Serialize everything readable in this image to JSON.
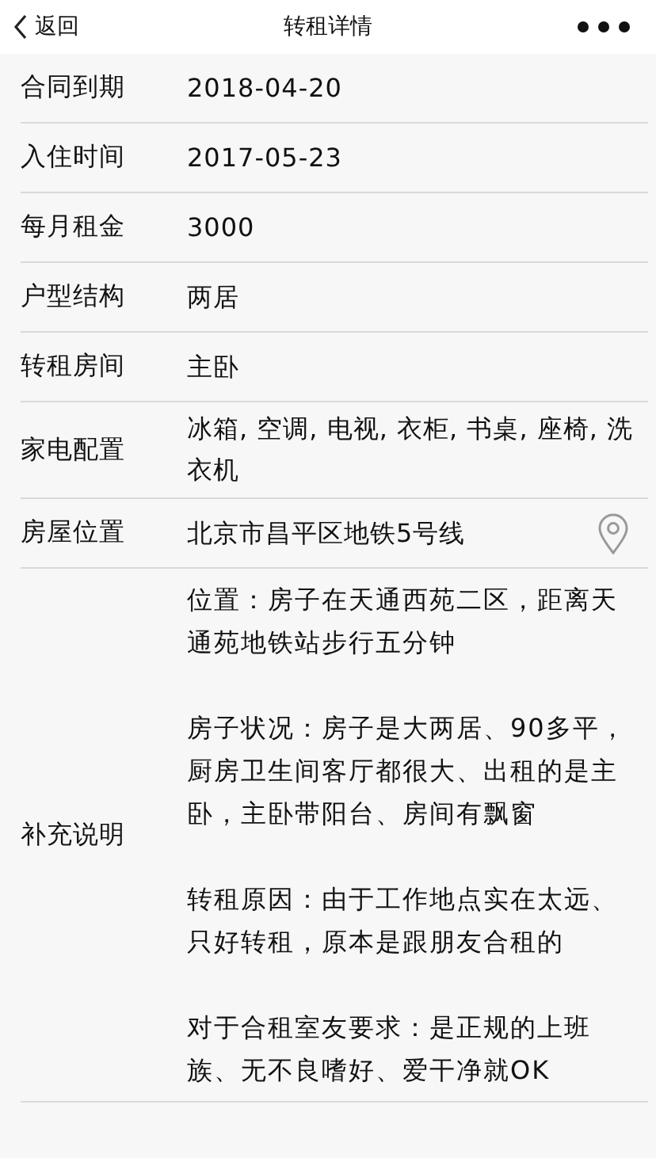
{
  "header": {
    "back_label": "返回",
    "title": "转租详情"
  },
  "rows": [
    {
      "kind": "text",
      "label": "合同到期",
      "value": "2018-04-20"
    },
    {
      "kind": "text",
      "label": "入住时间",
      "value": "2017-05-23"
    },
    {
      "kind": "text",
      "label": "每月租金",
      "value": "3000"
    },
    {
      "kind": "text",
      "label": "户型结构",
      "value": "两居"
    },
    {
      "kind": "text",
      "label": "转租房间",
      "value": "主卧"
    },
    {
      "kind": "text",
      "label": "家电配置",
      "value": "冰箱, 空调, 电视, 衣柜, 书桌, 座椅, 洗衣机"
    },
    {
      "kind": "location",
      "label": "房屋位置",
      "value": "北京市昌平区地铁5号线"
    },
    {
      "kind": "notes",
      "label": "补充说明",
      "paragraphs": [
        "位置：房子在天通西苑二区，距离天通苑地铁站步行五分钟",
        "房子状况：房子是大两居、90多平，厨房卫生间客厅都很大、出租的是主卧，主卧带阳台、房间有飘窗",
        "转租原因：由于工作地点实在太远、只好转租，原本是跟朋友合租的",
        "对于合租室友要求：是正规的上班族、无不良嗜好、爱干净就OK"
      ]
    }
  ]
}
